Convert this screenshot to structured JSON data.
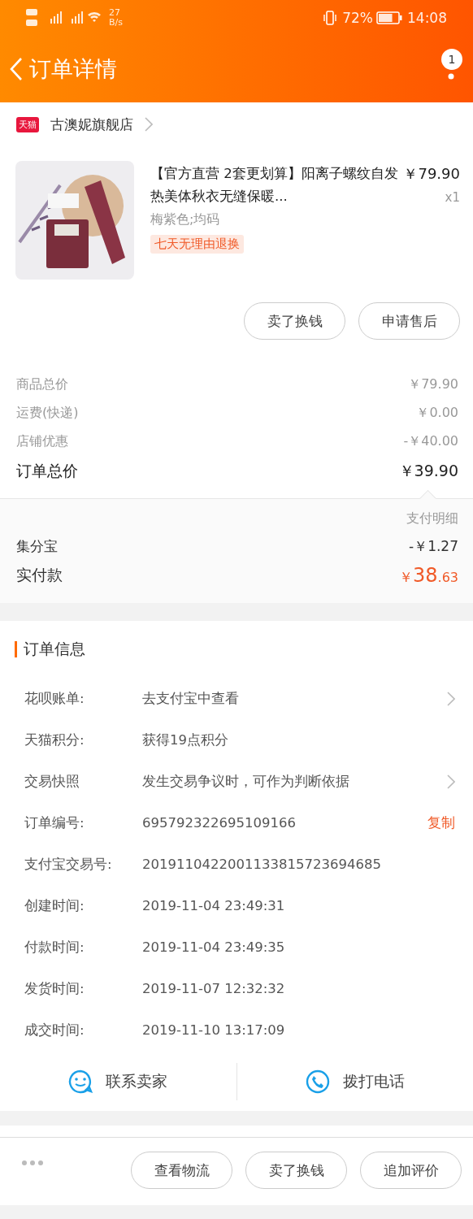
{
  "status_bar": {
    "network_speed": "27",
    "speed_unit": "B/s",
    "battery": "72%",
    "time": "14:08"
  },
  "header": {
    "title": "订单详情",
    "badge": "1"
  },
  "shop": {
    "tag": "天猫",
    "name": "古澳妮旗舰店"
  },
  "product": {
    "title": "【官方直营  2套更划算】阳离子螺纹自发热美体秋衣无缝保暖...",
    "price": "￥79.90",
    "quantity": "x1",
    "variant": "梅紫色;均码",
    "tag": "七天无理由退换"
  },
  "product_buttons": [
    "卖了换钱",
    "申请售后"
  ],
  "price_rows": [
    {
      "label": "商品总价",
      "value": "￥79.90",
      "kind": "minor"
    },
    {
      "label": "运费(快递)",
      "value": "￥0.00",
      "kind": "minor"
    },
    {
      "label": "店铺优惠",
      "value": "-￥40.00",
      "kind": "minor"
    },
    {
      "label": "订单总价",
      "value": "￥39.90",
      "kind": "total"
    }
  ],
  "payment": {
    "link": "支付明细",
    "discount_label": "集分宝",
    "discount_value": "-￥1.27",
    "paid_label": "实付款",
    "paid_currency": "￥",
    "paid_integer": "38",
    "paid_decimal": ".63"
  },
  "order_info": {
    "title": "订单信息",
    "rows": [
      {
        "label": "花呗账单:",
        "value": "去支付宝中查看",
        "kind": "link"
      },
      {
        "label": "天猫积分:",
        "value": "获得19点积分",
        "kind": "plain"
      },
      {
        "label": "交易快照",
        "value": "发生交易争议时，可作为判断依据",
        "kind": "link"
      },
      {
        "label": "订单编号:",
        "value": "695792322695109166",
        "kind": "copy",
        "action": "复制"
      },
      {
        "label": "支付宝交易号:",
        "value": "2019110422001133815723694685",
        "kind": "plain"
      },
      {
        "label": "创建时间:",
        "value": "2019-11-04 23:49:31",
        "kind": "plain"
      },
      {
        "label": "付款时间:",
        "value": "2019-11-04 23:49:35",
        "kind": "plain"
      },
      {
        "label": "发货时间:",
        "value": "2019-11-07 12:32:32",
        "kind": "plain"
      },
      {
        "label": "成交时间:",
        "value": "2019-11-10 13:17:09",
        "kind": "plain"
      }
    ]
  },
  "contact": [
    {
      "label": "联系卖家",
      "kind": "chat"
    },
    {
      "label": "拨打电话",
      "kind": "phone"
    }
  ],
  "bottom_bar": {
    "buttons": [
      "查看物流",
      "卖了换钱",
      "追加评价"
    ]
  }
}
